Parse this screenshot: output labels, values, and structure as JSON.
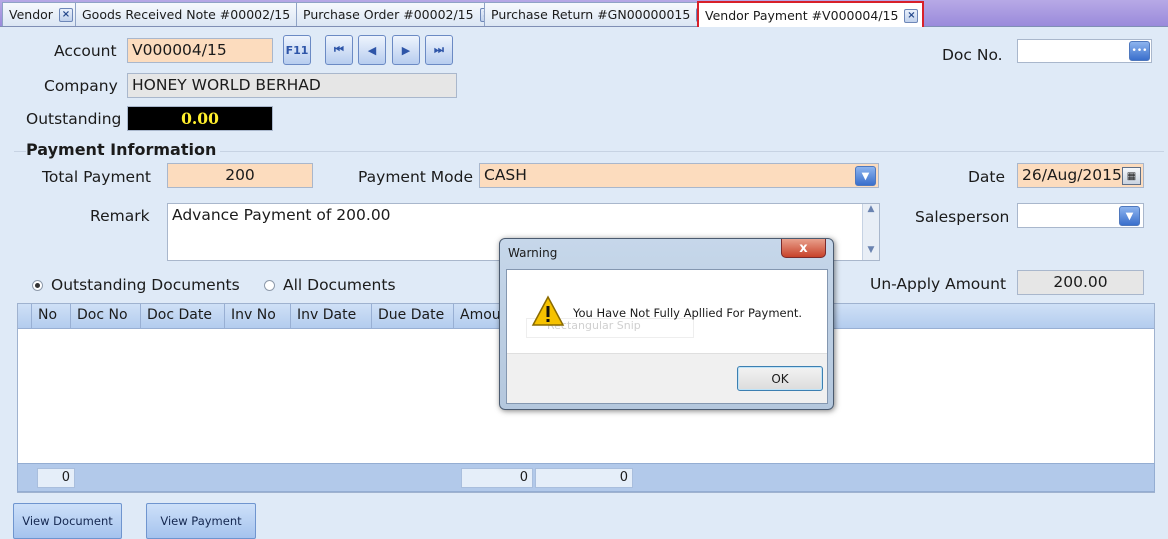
{
  "tabs": [
    {
      "label": "Vendor"
    },
    {
      "label": "Goods Received Note #00002/15"
    },
    {
      "label": "Purchase Order #00002/15"
    },
    {
      "label": "Purchase Return #GN00000015"
    },
    {
      "label": "Vendor Payment #V000004/15"
    }
  ],
  "header": {
    "account_label": "Account",
    "account_value": "V000004/15",
    "f11_label": "F11",
    "company_label": "Company",
    "company_value": "HONEY WORLD BERHAD",
    "outstanding_label": "Outstanding",
    "outstanding_value": "0.00",
    "docno_label": "Doc No.",
    "docno_value": ""
  },
  "payment": {
    "section_title": "Payment Information",
    "total_label": "Total Payment",
    "total_value": "200",
    "mode_label": "Payment Mode",
    "mode_value": "CASH",
    "date_label": "Date",
    "date_value": "26/Aug/2015",
    "remark_label": "Remark",
    "remark_value": "Advance Payment of 200.00",
    "salesperson_label": "Salesperson",
    "salesperson_value": ""
  },
  "filter": {
    "outstanding_docs": "Outstanding Documents",
    "all_docs": "All Documents",
    "unapply_label": "Un-Apply Amount",
    "unapply_value": "200.00"
  },
  "grid": {
    "columns": [
      "No",
      "Doc No",
      "Doc Date",
      "Inv No",
      "Inv Date",
      "Due Date",
      "Amou"
    ],
    "footer": [
      "0",
      "0",
      "0"
    ]
  },
  "buttons": {
    "view_document": "View Document",
    "view_payment": "View Payment"
  },
  "dialog": {
    "title": "Warning",
    "close": "x",
    "message": "You Have Not Fully Apllied For Payment.",
    "ghost_text": "Rectangular Snip",
    "ok": "OK"
  },
  "colors": {
    "peach": "#fcdcbe",
    "active_tab_border": "#d8202a",
    "outstanding_text": "#ffef2d"
  }
}
